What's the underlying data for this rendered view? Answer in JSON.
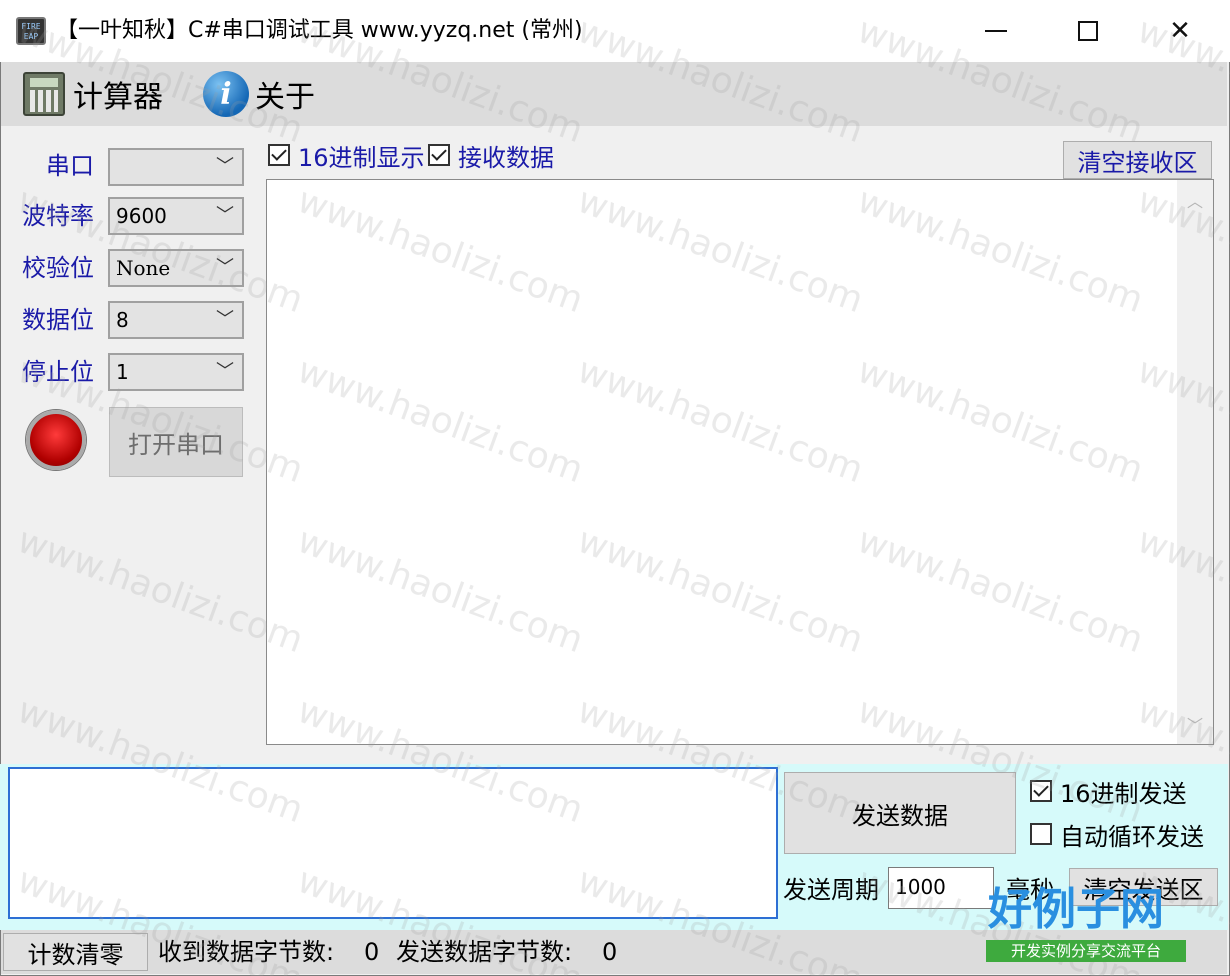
{
  "window": {
    "title": "【一叶知秋】C#串口调试工具  www.yyzq.net  (常州)",
    "app_icon_text": "FIRE EAP"
  },
  "menu": {
    "calculator": "计算器",
    "about": "关于"
  },
  "serial_settings": {
    "port_label": "串口",
    "port_value": "",
    "baud_label": "波特率",
    "baud_value": "9600",
    "parity_label": "校验位",
    "parity_value": "None",
    "databits_label": "数据位",
    "databits_value": "8",
    "stopbits_label": "停止位",
    "stopbits_value": "1",
    "open_button": "打开串口",
    "status_led_color": "#d01010"
  },
  "receive": {
    "hex_display_label": "16进制显示",
    "hex_display_checked": true,
    "receive_data_label": "接收数据",
    "receive_data_checked": true,
    "clear_button": "清空接收区",
    "content": ""
  },
  "send": {
    "content": "",
    "send_button": "发送数据",
    "hex_send_label": "16进制发送",
    "hex_send_checked": true,
    "auto_send_label": "自动循环发送",
    "auto_send_checked": false,
    "period_label": "发送周期",
    "period_value": "1000",
    "period_unit": "毫秒",
    "clear_button": "清空发送区"
  },
  "status": {
    "reset_button": "计数清零",
    "rx_label": "收到数据字节数:",
    "rx_value": "0",
    "tx_label": "发送数据字节数:",
    "tx_value": "0"
  },
  "watermark": {
    "text": "www.haolizi.com",
    "logo_title": "好例子网",
    "logo_subtitle": "开发实例分享交流平台"
  },
  "colors": {
    "label_blue": "#1a1aa8",
    "send_panel_bg": "#d6fafa",
    "send_area_border": "#2d6fd4",
    "led_red": "#d01010"
  }
}
